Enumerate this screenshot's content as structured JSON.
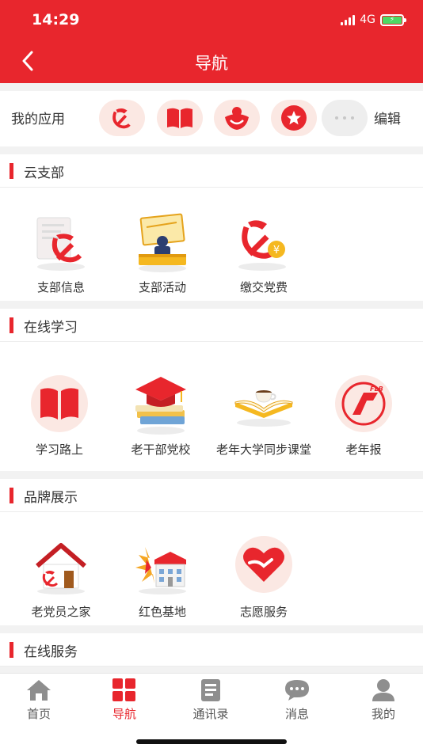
{
  "status": {
    "time": "14:29",
    "network": "4G"
  },
  "header": {
    "title": "导航",
    "back_icon": "back-chevron-icon"
  },
  "my_apps": {
    "label": "我的应用",
    "edit": "编辑",
    "icons": [
      "party-emblem-icon",
      "book-icon",
      "volunteer-icon",
      "star-badge-icon",
      "more-icon"
    ]
  },
  "sections": [
    {
      "title": "云支部",
      "items": [
        {
          "label": "支部信息",
          "icon": "party-document-icon"
        },
        {
          "label": "支部活动",
          "icon": "meeting-speaker-icon"
        },
        {
          "label": "缴交党费",
          "icon": "party-fee-icon"
        }
      ]
    },
    {
      "title": "在线学习",
      "items": [
        {
          "label": "学习路上",
          "icon": "book-icon"
        },
        {
          "label": "老干部党校",
          "icon": "graduation-cap-icon"
        },
        {
          "label": "老年大学同步课堂",
          "icon": "coffee-book-icon"
        },
        {
          "label": "老年报",
          "icon": "newspaper-logo-icon"
        }
      ]
    },
    {
      "title": "品牌展示",
      "items": [
        {
          "label": "老党员之家",
          "icon": "party-home-icon"
        },
        {
          "label": "红色基地",
          "icon": "red-base-icon"
        },
        {
          "label": "志愿服务",
          "icon": "volunteer-heart-icon"
        }
      ]
    },
    {
      "title": "在线服务",
      "items": []
    }
  ],
  "tabbar": {
    "active": "导航",
    "tabs": [
      {
        "label": "首页",
        "icon": "home-icon"
      },
      {
        "label": "导航",
        "icon": "grid-icon"
      },
      {
        "label": "通讯录",
        "icon": "contacts-book-icon"
      },
      {
        "label": "消息",
        "icon": "chat-bubble-icon"
      },
      {
        "label": "我的",
        "icon": "person-icon"
      }
    ]
  },
  "colors": {
    "primary": "#e8262d",
    "accent_gold": "#f5b820",
    "icon_bg": "#fbe8e3",
    "background": "#f2f2f2"
  }
}
